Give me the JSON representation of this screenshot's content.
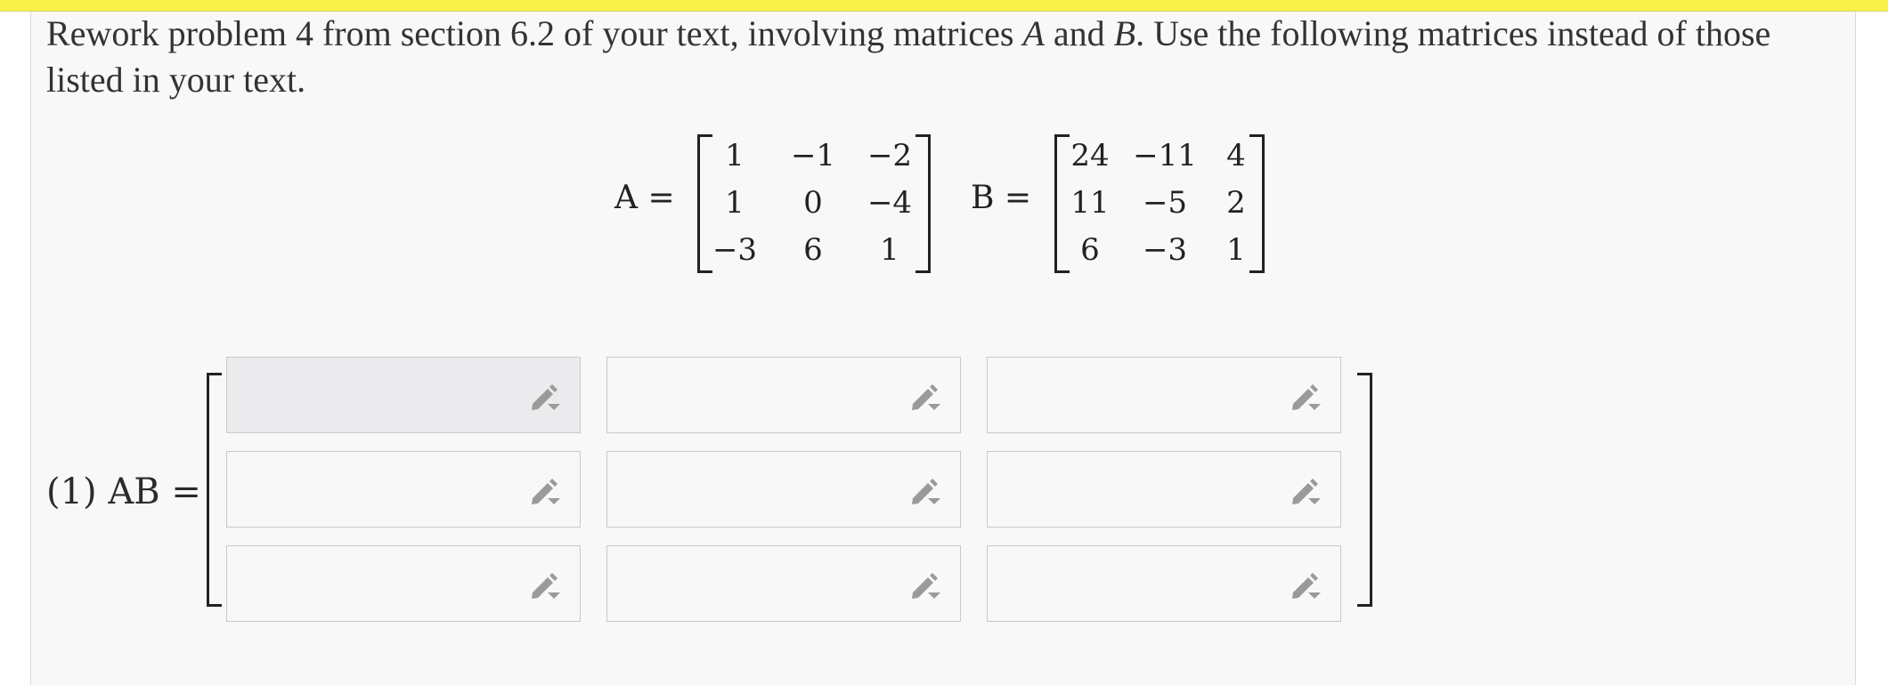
{
  "problem": {
    "text_part1": "Rework problem 4 from section 6.2 of your text, involving matrices ",
    "var_a": "A",
    "text_and": " and ",
    "var_b": "B",
    "text_part2": ". Use the following matrices instead of those listed in your text."
  },
  "matrix_a": {
    "label": "A =",
    "rows": [
      [
        "1",
        "−1",
        "−2"
      ],
      [
        "1",
        "0",
        "−4"
      ],
      [
        "−3",
        "6",
        "1"
      ]
    ]
  },
  "matrix_b": {
    "label": "B =",
    "rows": [
      [
        "24",
        "−11",
        "4"
      ],
      [
        "11",
        "−5",
        "2"
      ],
      [
        "6",
        "−3",
        "1"
      ]
    ]
  },
  "answer": {
    "label": "(1) AB ="
  },
  "icons": {
    "edit": "pencil-icon"
  },
  "colors": {
    "top_bar": "#f7f14a",
    "panel_bg": "#f8f8f8",
    "active_box": "#ebebee",
    "icon": "#9a9a9a"
  }
}
